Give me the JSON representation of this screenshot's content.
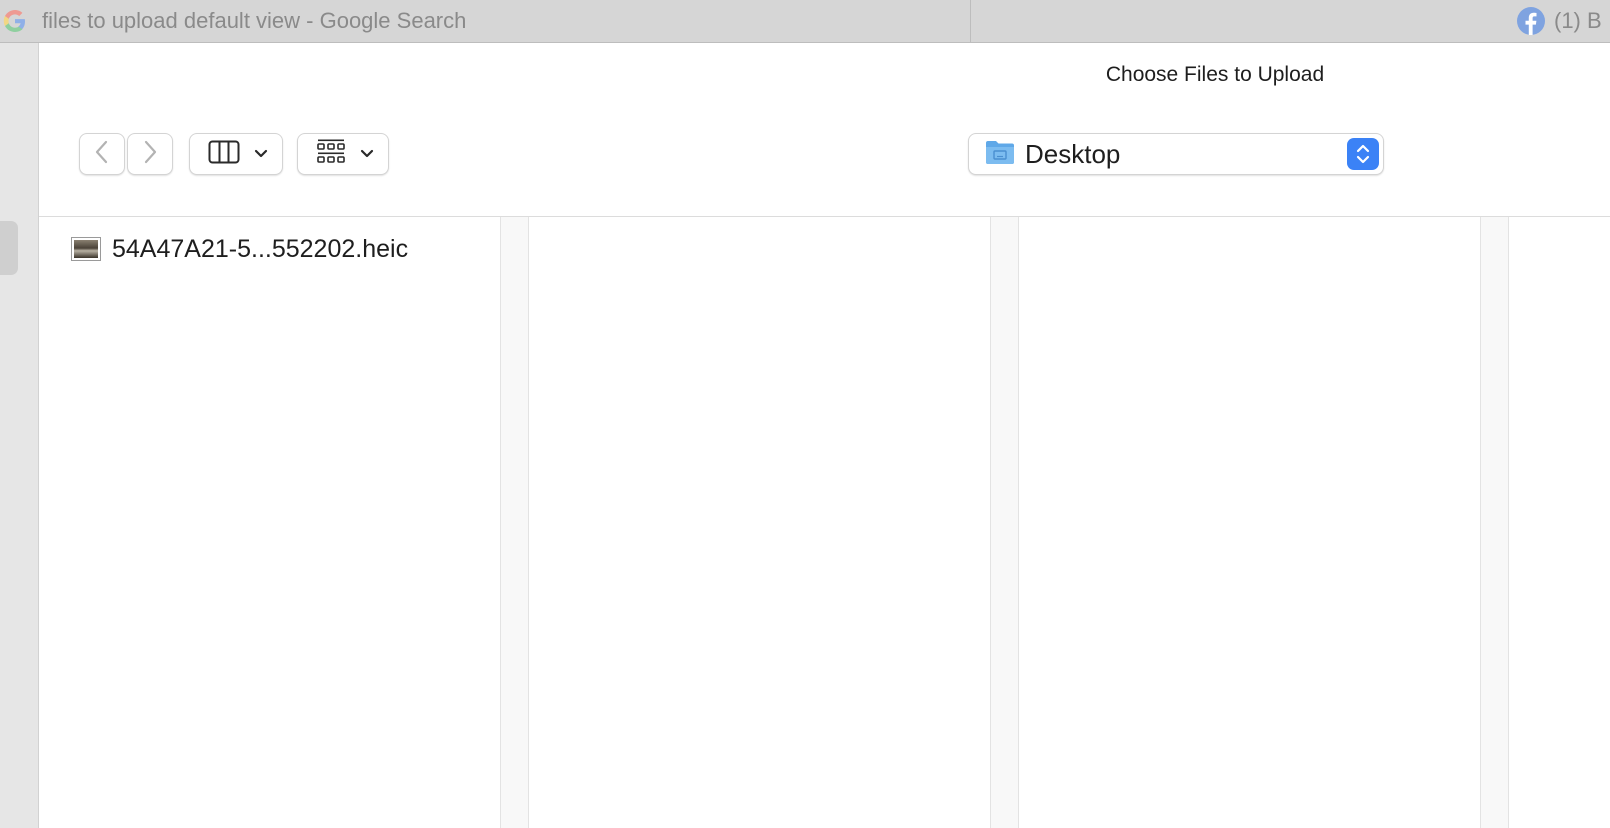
{
  "browser": {
    "tabs": [
      {
        "title": "files to upload default view - Google Search",
        "favicon": "google-icon"
      },
      {
        "title": "(1) B",
        "favicon": "facebook-icon"
      }
    ]
  },
  "dialog": {
    "title": "Choose Files to Upload",
    "toolbar": {
      "back_icon": "chevron-left-icon",
      "forward_icon": "chevron-right-icon",
      "view_mode_icon": "column-view-icon",
      "group_mode_icon": "group-grid-icon"
    },
    "location": {
      "label": "Desktop",
      "icon": "desktop-folder-icon"
    },
    "columns": [
      {
        "items": [
          {
            "name": "54A47A21-5...552202.heic",
            "icon": "image-file-icon"
          }
        ]
      },
      {
        "items": []
      },
      {
        "items": []
      },
      {
        "items": []
      }
    ]
  },
  "colors": {
    "accent": "#3b82f6",
    "tabstrip": "#d6d6d6",
    "tab_text": "#8a8a8a",
    "folder_blue": "#5fa8e8"
  }
}
